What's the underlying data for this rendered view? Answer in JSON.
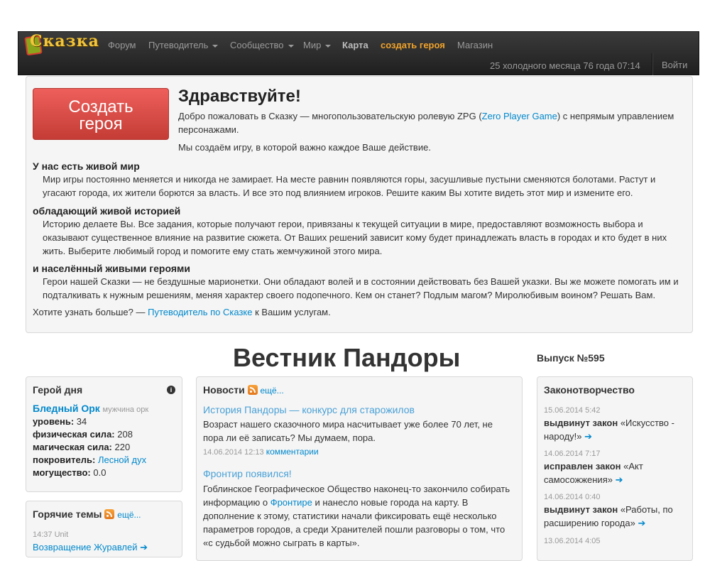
{
  "brand": {
    "logo_text": "Сказка"
  },
  "nav": {
    "items": [
      {
        "label": "Форум",
        "dropdown": false
      },
      {
        "label": "Путеводитель",
        "dropdown": true
      },
      {
        "label": "Сообщество",
        "dropdown": true
      },
      {
        "label": "Мир",
        "dropdown": true
      },
      {
        "label": "Карта",
        "dropdown": false
      },
      {
        "label": "создать героя",
        "dropdown": false
      },
      {
        "label": "Магазин",
        "dropdown": false
      }
    ],
    "game_date": "25 холодного месяца 76 года 07:14",
    "login_label": "Войти"
  },
  "hero": {
    "create_button_line1": "Создать",
    "create_button_line2": "героя",
    "title": "Здравствуйте!",
    "intro_before": "Добро пожаловать в Сказку — многопользовательскую ролевую ZPG (",
    "intro_link": "Zero Player Game",
    "intro_after": ") с непрямым управлением персонажами.",
    "intro2": "Мы создаём игру, в которой важно каждое Ваше действие.",
    "sections": [
      {
        "heading": "У нас есть живой мир",
        "text": "Мир игры постоянно меняется и никогда не замирает. На месте равнин появляются горы, засушливые пустыни сменяются болотами. Растут и угасают города, их жители борются за власть. И все это под влиянием игроков. Решите каким Вы хотите видеть этот мир и измените его."
      },
      {
        "heading": "обладающий живой историей",
        "text": "Историю делаете Вы. Все задания, которые получают герои, привязаны к текущей ситуации в мире, предоставляют возможность выбора и оказывают существенное влияние на развитие сюжета. От Ваших решений зависит кому будет принадлежать власть в городах и кто будет в них жить. Выберите любимый город и помогите ему стать жемчужиной этого мира."
      },
      {
        "heading": "и населённый живыми героями",
        "text": "Герои нашей Сказки — не бездушные марионетки. Они обладают волей и в состоянии действовать без Вашей указки. Вы же можете помогать им и подталкивать к нужным решениям, меняя характер своего подопечного. Кем он станет? Подлым магом? Миролюбивым воином? Решать Вам."
      }
    ],
    "more_before": "Хотите узнать больше? — ",
    "more_link": "Путеводитель по Сказке",
    "more_after": " к Вашим услугам."
  },
  "vestnik": {
    "title": "Вестник Пандоры",
    "issue": "Выпуск №595"
  },
  "hero_of_day": {
    "title": "Герой дня",
    "name": "Бледный Орк",
    "desc": "мужчина орк",
    "level_label": "уровень:",
    "level": "34",
    "phys_label": "физическая сила:",
    "phys": "208",
    "magic_label": "магическая сила:",
    "magic": "220",
    "patron_label": "покровитель:",
    "patron": "Лесной дух",
    "might_label": "могущество:",
    "might": "0.0"
  },
  "hot_topics": {
    "title": "Горячие темы",
    "more": "ещё...",
    "first_meta": "14:37 Unit",
    "first_title": "Возвращение Журавлей"
  },
  "news": {
    "title": "Новости",
    "more": "ещё...",
    "items": [
      {
        "title": "История Пандоры — конкурс для старожилов",
        "text": "Возраст нашего сказочного мира насчитывает уже более 70 лет, не пора ли её записать? Мы думаем, пора.",
        "date": "14.06.2014 12:13",
        "comments": "комментарии"
      },
      {
        "title": "Фронтир появился!",
        "text_before": "Гоблинское Географическое Общество наконец-то закончило собирать информацию о ",
        "text_link": "Фронтире",
        "text_after": " и нанесло новые города на карту. В дополнение к этому, статистики начали фиксировать ещё несколько параметров городов, а среди Хранителей пошли разговоры о том, что «с судьбой можно сыграть в карты»."
      }
    ]
  },
  "laws": {
    "title": "Законотворчество",
    "items": [
      {
        "date": "15.06.2014 5:42",
        "action": "выдвинут закон",
        "text": "«Искусство - народу!»"
      },
      {
        "date": "14.06.2014 7:17",
        "action": "исправлен закон",
        "text": "«Акт самосожжения»"
      },
      {
        "date": "14.06.2014 0:40",
        "action": "выдвинут закон",
        "text": "«Работы, по расширению города»"
      },
      {
        "date": "13.06.2014 4:05",
        "action": "",
        "text": ""
      }
    ]
  }
}
